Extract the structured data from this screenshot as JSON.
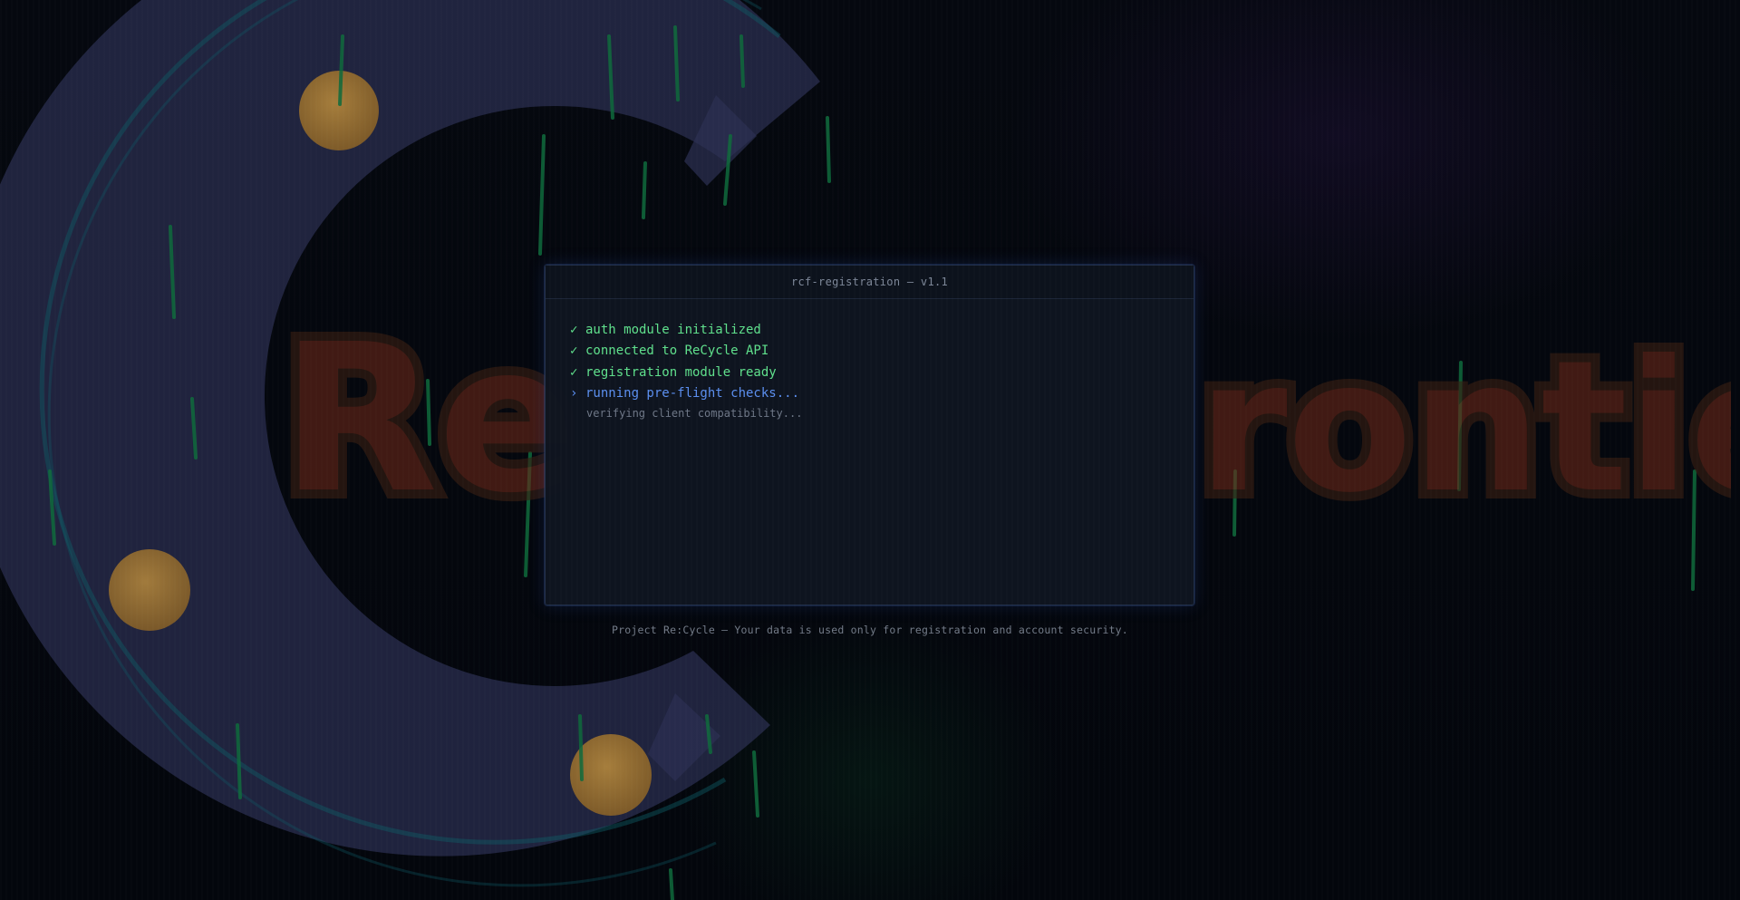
{
  "background": {
    "logo_text_left": "Re",
    "logo_text_right": "rontier",
    "colors": {
      "ring": "#2b2f52",
      "ring_stroke": "#0e5a63",
      "orb": "#a57a33",
      "vine": "#0f6a3c",
      "logo_fill": "#6b2818",
      "logo_outline": "#3a1f12"
    }
  },
  "terminal": {
    "title": "rcf-registration — v1.1",
    "lines": [
      {
        "status": "done",
        "icon": "check-icon",
        "mark": "✓",
        "text": "auth module initialized"
      },
      {
        "status": "done",
        "icon": "check-icon",
        "mark": "✓",
        "text": "connected to ReCycle API"
      },
      {
        "status": "done",
        "icon": "check-icon",
        "mark": "✓",
        "text": "registration module ready"
      },
      {
        "status": "active",
        "icon": "chevron-right-icon",
        "mark": "›",
        "text": "running pre-flight checks..."
      }
    ],
    "sub_status": "verifying client compatibility...",
    "colors": {
      "ok": "#5fe08c",
      "active": "#5b8ff0",
      "muted": "#6e7787"
    }
  },
  "footer": {
    "note": "Project Re:Cycle — Your data is used only for registration and account security."
  }
}
